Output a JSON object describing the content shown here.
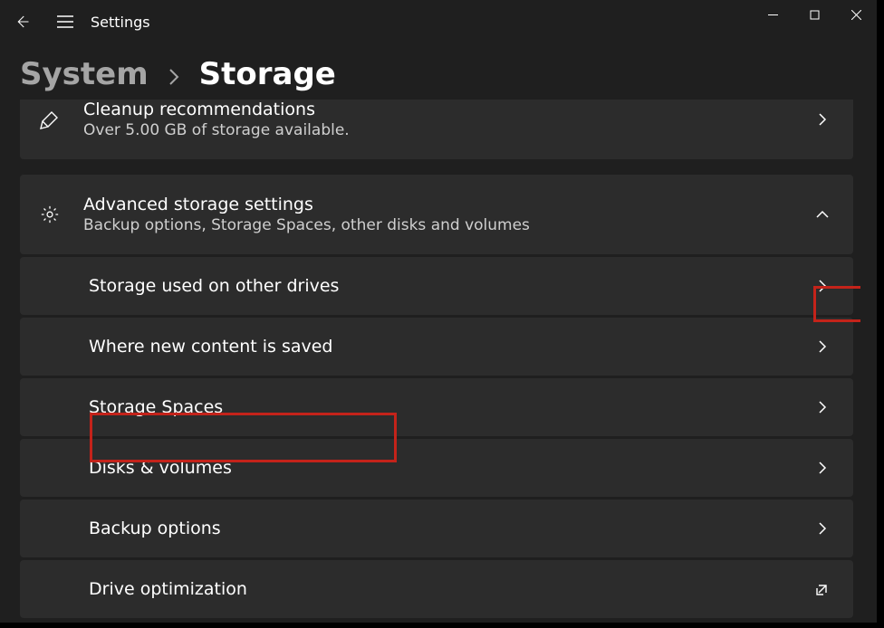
{
  "appTitle": "Settings",
  "breadcrumb": {
    "parent": "System",
    "current": "Storage"
  },
  "cleanup": {
    "title": "Cleanup recommendations",
    "subtitle": "Over 5.00 GB of storage available."
  },
  "advanced": {
    "title": "Advanced storage settings",
    "subtitle": "Backup options, Storage Spaces, other disks and volumes",
    "items": [
      {
        "label": "Storage used on other drives",
        "action": "navigate"
      },
      {
        "label": "Where new content is saved",
        "action": "navigate"
      },
      {
        "label": "Storage Spaces",
        "action": "navigate"
      },
      {
        "label": "Disks & volumes",
        "action": "navigate"
      },
      {
        "label": "Backup options",
        "action": "navigate"
      },
      {
        "label": "Drive optimization",
        "action": "external"
      }
    ]
  }
}
